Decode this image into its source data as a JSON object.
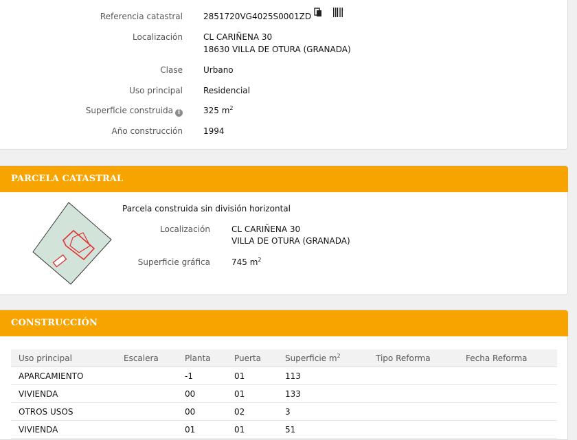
{
  "inmueble": {
    "rows": [
      {
        "label": "Referencia catastral",
        "value": "2851720VG4025S0001ZD"
      },
      {
        "label": "Localización",
        "line1": "CL CARIÑENA 30",
        "line2": "18630 VILLA DE OTURA (GRANADA)"
      },
      {
        "label": "Clase",
        "value": "Urbano"
      },
      {
        "label": "Uso principal",
        "value": "Residencial"
      },
      {
        "label": "Superficie construida",
        "value": "325 m",
        "sup": "2"
      },
      {
        "label": "Año construcción",
        "value": "1994"
      }
    ]
  },
  "parcela": {
    "header": "PARCELA CATASTRAL",
    "description": "Parcela construida sin división horizontal",
    "loc_label": "Localización",
    "loc_line1": "CL CARIÑENA 30",
    "loc_line2": "VILLA DE OTURA (GRANADA)",
    "sup_label": "Superficie gráfica",
    "sup_value": "745 m",
    "sup_exp": "2"
  },
  "construccion": {
    "header": "CONSTRUCCIÓN",
    "columns": [
      "Uso principal",
      "Escalera",
      "Planta",
      "Puerta",
      "Superficie m",
      "Tipo Reforma",
      "Fecha Reforma"
    ],
    "sup_col_exp": "2",
    "rows": [
      {
        "uso": "APARCAMIENTO",
        "escalera": "",
        "planta": "-1",
        "puerta": "01",
        "superficie": "113",
        "tipo": "",
        "fecha": ""
      },
      {
        "uso": "VIVIENDA",
        "escalera": "",
        "planta": "00",
        "puerta": "01",
        "superficie": "133",
        "tipo": "",
        "fecha": ""
      },
      {
        "uso": "OTROS USOS",
        "escalera": "",
        "planta": "00",
        "puerta": "02",
        "superficie": "3",
        "tipo": "",
        "fecha": ""
      },
      {
        "uso": "VIVIENDA",
        "escalera": "",
        "planta": "01",
        "puerta": "01",
        "superficie": "51",
        "tipo": "",
        "fecha": ""
      }
    ]
  },
  "colors": {
    "accent": "#f7a300",
    "parcel_fill": "#d2e4d9",
    "building_outline": "#e03030"
  }
}
